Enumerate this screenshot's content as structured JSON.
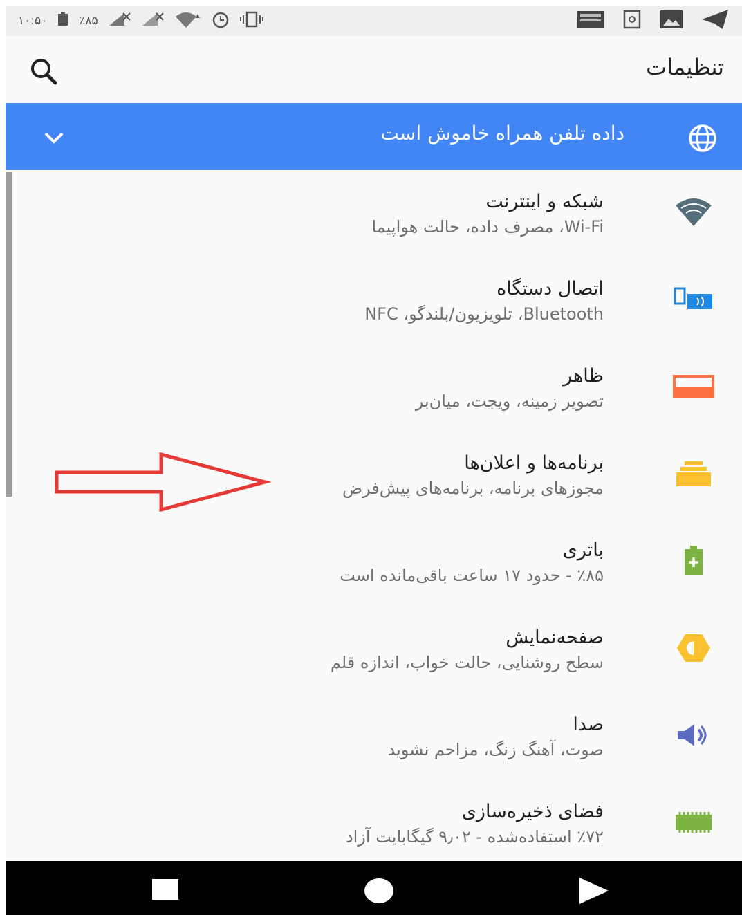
{
  "status_bar": {
    "time": "۱۰:۵۰",
    "battery": "٪۸۵"
  },
  "app_bar": {
    "title": "تنظیمات",
    "search_icon": "search-icon"
  },
  "banner": {
    "text": "داده تلفن همراه خاموش است",
    "icon": "globe-icon",
    "color": "#4285f4"
  },
  "settings": {
    "items": [
      {
        "title": "شبکه و اینترنت",
        "subtitle": "Wi-Fi، مصرف داده، حالت هواپیما",
        "icon": "wifi-icon"
      },
      {
        "title": "اتصال دستگاه",
        "subtitle": "Bluetooth، تلویزیون/بلندگو، NFC",
        "icon": "device-connection-icon"
      },
      {
        "title": "ظاهر",
        "subtitle": "تصویر زمینه، ویجت، میان‌بر",
        "icon": "display-appearance-icon"
      },
      {
        "title": "برنامه‌ها و اعلان‌ها",
        "subtitle": "مجوزهای برنامه، برنامه‌های پیش‌فرض",
        "icon": "apps-icon"
      },
      {
        "title": "باتری",
        "subtitle": "٪۸۵ - حدود ۱۷ ساعت باقی‌مانده است",
        "icon": "battery-icon"
      },
      {
        "title": "صفحه‌نمایش",
        "subtitle": "سطح روشنایی، حالت خواب، اندازه قلم",
        "icon": "brightness-icon"
      },
      {
        "title": "صدا",
        "subtitle": "صوت، آهنگ زنگ، مزاحم نشوید",
        "icon": "volume-icon"
      },
      {
        "title": "فضای ذخیره‌سازی",
        "subtitle": "٪۷۲ استفاده‌شده - ۹٫۰۲ گیگابایت آزاد",
        "icon": "storage-icon"
      }
    ]
  },
  "colors": {
    "wifi": "#546e7a",
    "device": "#1e88e5",
    "appearance": "#ff7043",
    "apps": "#fbc02d",
    "battery": "#7cb342",
    "brightness": "#fbc02d",
    "volume": "#5c6bc0",
    "storage": "#7cb342",
    "annotation_arrow": "#e53935"
  }
}
